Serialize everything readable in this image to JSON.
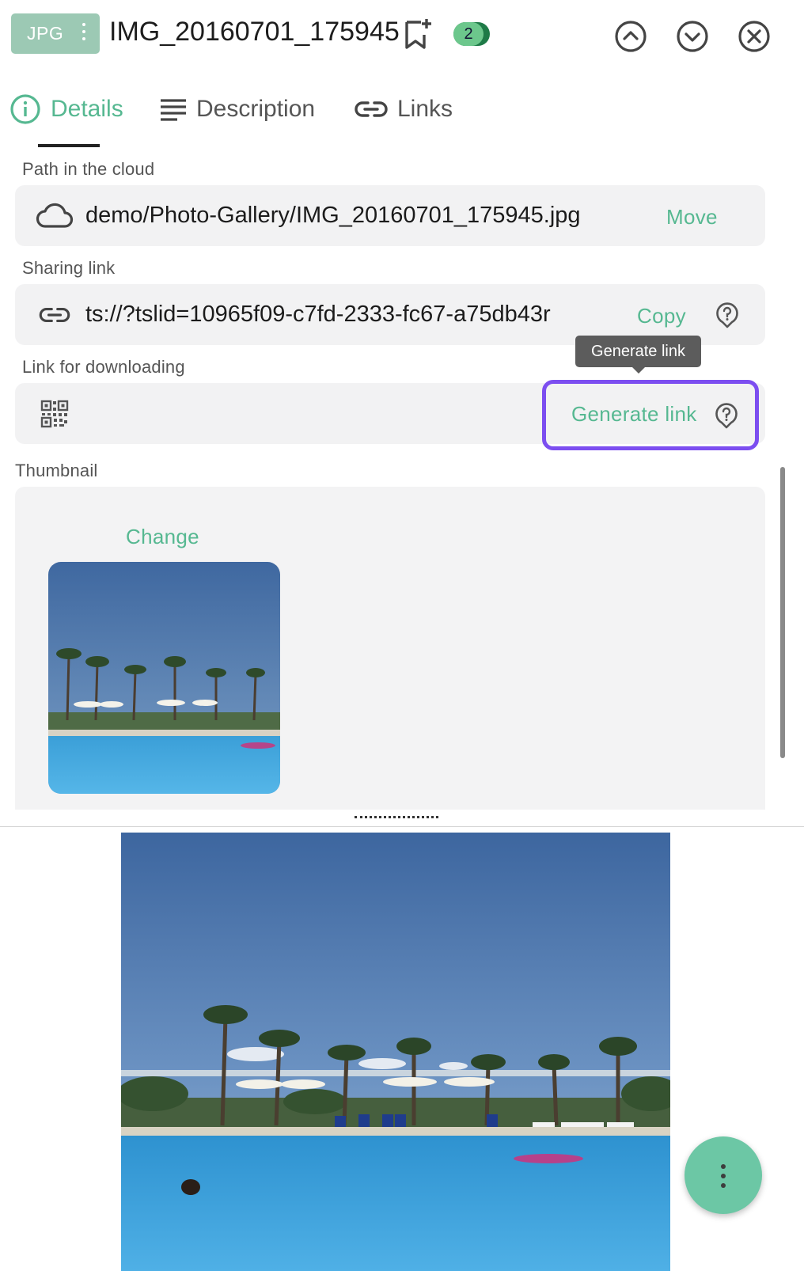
{
  "header": {
    "file_extension": "JPG",
    "file_name": "IMG_20160701_175945",
    "tag_count": "2",
    "icons": [
      "more-vert-icon",
      "bookmark-add-icon",
      "chevron-up-icon",
      "chevron-down-icon",
      "close-icon"
    ]
  },
  "tabs": [
    {
      "label": "Details",
      "icon": "info-icon",
      "active": true
    },
    {
      "label": "Description",
      "icon": "text-lines-icon",
      "active": false
    },
    {
      "label": "Links",
      "icon": "link-icon",
      "active": false
    }
  ],
  "details": {
    "path": {
      "label": "Path in the cloud",
      "value": "demo/Photo-Gallery/IMG_20160701_175945.jpg",
      "action": "Move"
    },
    "sharing": {
      "label": "Sharing link",
      "value": "ts://?tslid=10965f09-c7fd-2333-fc67-a75db43r",
      "action": "Copy"
    },
    "download": {
      "label": "Link for downloading",
      "action": "Generate link",
      "tooltip": "Generate link"
    },
    "thumbnail": {
      "label": "Thumbnail",
      "action": "Change"
    }
  },
  "colors": {
    "accent": "#56b891",
    "badge": "#9cc9b4",
    "focus_outline": "#7c4ef0",
    "fab": "#6cc7a5"
  }
}
